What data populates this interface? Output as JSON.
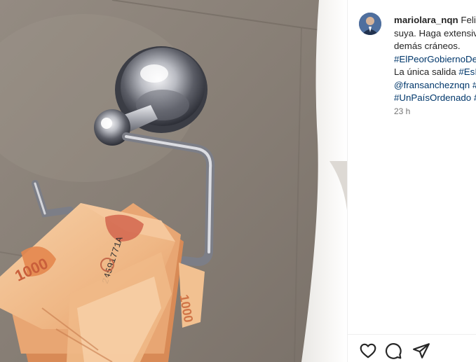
{
  "post": {
    "username": "mariolara_nqn",
    "caption_lines": [
      "Feliz",
      "suya. Haga extensiv",
      "demás cráneos."
    ],
    "hashtag_line": "#ElPeorGobiernoDe",
    "cta_prefix": "La única salida ",
    "cta_tag": "#EsI",
    "mentions_line": "@fransancheznqn #",
    "last_tag": "#UnPaísOrdenado #",
    "timestamp": "23 h"
  },
  "actions": {
    "like_icon": "heart-outline-icon",
    "comment_icon": "speech-bubble-icon",
    "share_icon": "paper-plane-icon"
  },
  "image": {
    "subject": "chrome toilet paper holder with a stack of 1000 peso banknotes",
    "banknote_denomination": "1000",
    "banknote_serial": "24591771A"
  },
  "colors": {
    "text": "#262626",
    "link": "#00376b",
    "muted": "#737373",
    "divider": "#efefef"
  }
}
